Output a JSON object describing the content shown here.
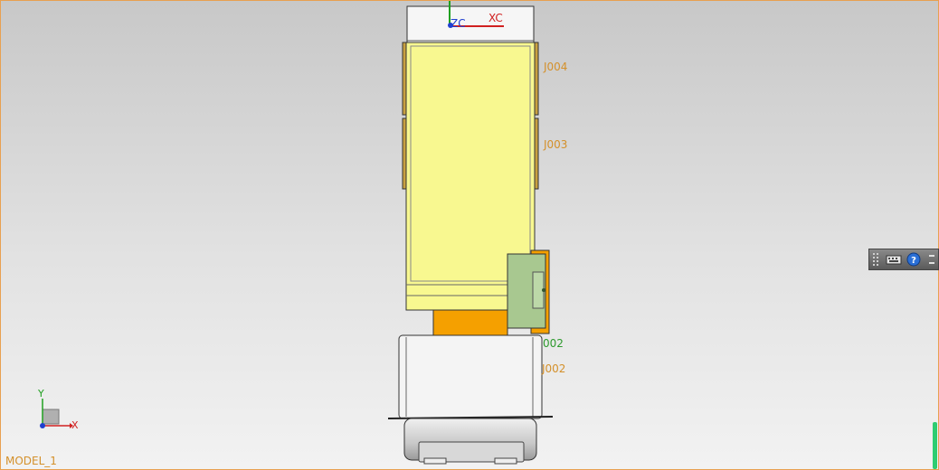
{
  "viewport": {
    "model_name": "MODEL_1",
    "wcs": {
      "x_label": "XC",
      "z_label": "ZC"
    },
    "triad": {
      "x_label": "X",
      "y_label": "Y"
    },
    "labels": {
      "j004": "J004",
      "j003": "J003",
      "green_002": "002",
      "j002": "J002"
    }
  },
  "toolbar": {
    "icons": [
      "grip-icon",
      "keyboard-icon",
      "help-icon",
      "collapse-icon"
    ]
  },
  "colors": {
    "part_yellow": "#f8f890",
    "part_orange": "#f5a000",
    "part_green": "#a8c890",
    "part_white": "#f4f4f4",
    "label_orange": "#d4902a",
    "label_green": "#2e9a2e",
    "axis_x": "#d02020",
    "axis_y": "#20a020",
    "axis_z": "#2040d0"
  }
}
